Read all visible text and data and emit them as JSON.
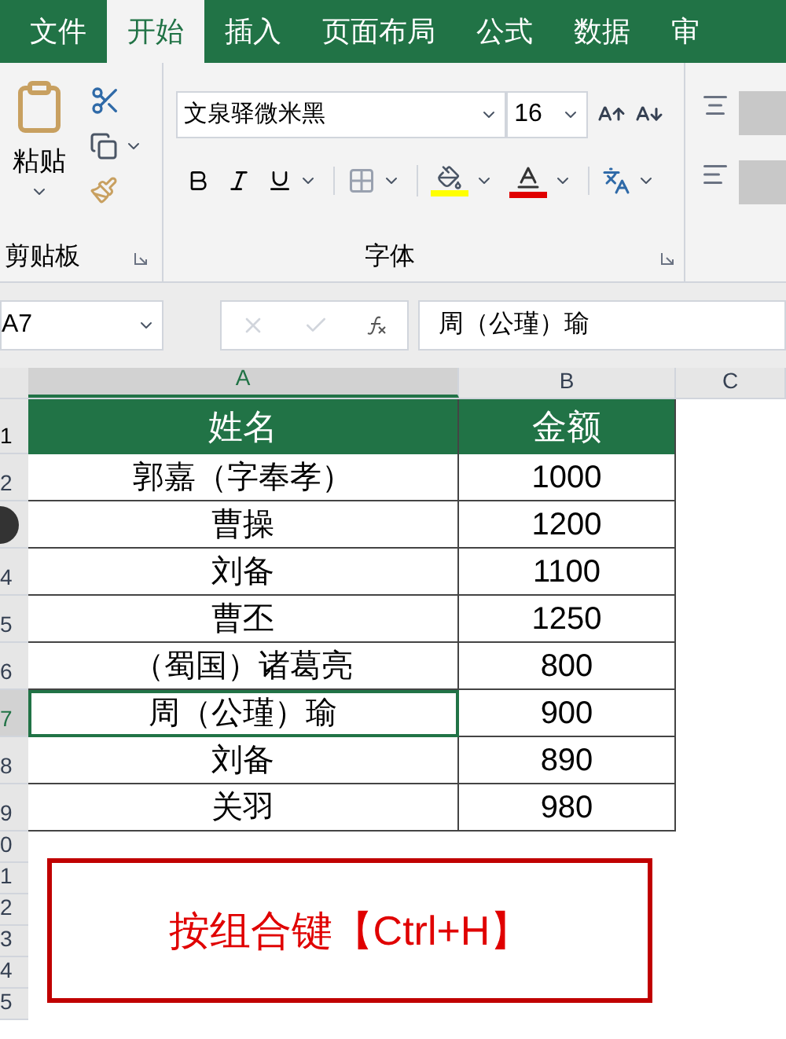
{
  "tabs": [
    {
      "label": "文件",
      "selected": false
    },
    {
      "label": "开始",
      "selected": true
    },
    {
      "label": "插入",
      "selected": false
    },
    {
      "label": "页面布局",
      "selected": false
    },
    {
      "label": "公式",
      "selected": false
    },
    {
      "label": "数据",
      "selected": false
    },
    {
      "label": "审",
      "selected": false
    }
  ],
  "ribbon": {
    "paste_label": "粘贴",
    "clipboard_group": "剪贴板",
    "font_name": "文泉驿微米黑",
    "font_size": "16",
    "font_group": "字体"
  },
  "formula_bar": {
    "name_box": "A7",
    "formula": "周（公瑾）瑜"
  },
  "columns": [
    {
      "label": "A",
      "selected": true
    },
    {
      "label": "B",
      "selected": false
    },
    {
      "label": "C",
      "selected": false
    }
  ],
  "header_row": {
    "number": "1",
    "cells": [
      "姓名",
      "金额"
    ]
  },
  "rows": [
    {
      "number": "2",
      "selected": false,
      "cells": [
        "郭嘉（字奉孝）",
        "1000"
      ]
    },
    {
      "cursor": true,
      "selected": false,
      "cells": [
        "曹操",
        "1200"
      ]
    },
    {
      "number": "4",
      "selected": false,
      "cells": [
        "刘备",
        "1100"
      ]
    },
    {
      "number": "5",
      "selected": false,
      "cells": [
        "曹丕",
        "1250"
      ]
    },
    {
      "number": "6",
      "selected": false,
      "cells": [
        "（蜀国）诸葛亮",
        "800"
      ]
    },
    {
      "number": "7",
      "selected": true,
      "cells": [
        "周（公瑾）瑜",
        "900"
      ]
    },
    {
      "number": "8",
      "selected": false,
      "cells": [
        "刘备",
        "890"
      ]
    },
    {
      "number": "9",
      "selected": false,
      "cells": [
        "关羽",
        "980"
      ]
    }
  ],
  "empty_rows": [
    "0",
    "1",
    "2",
    "3",
    "4",
    "5"
  ],
  "note": "按组合键【Ctrl+H】"
}
